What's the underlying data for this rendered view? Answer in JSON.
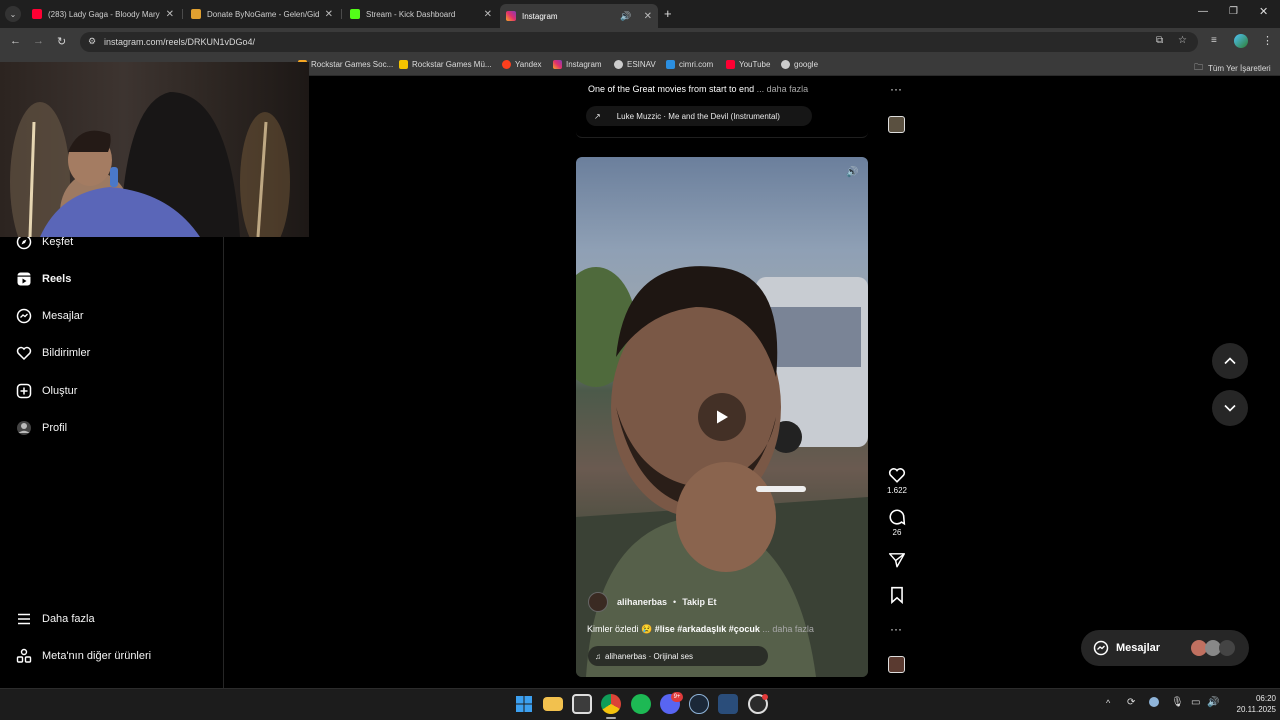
{
  "browser": {
    "tabs": [
      {
        "label": "(283) Lady Gaga - Bloody Mary",
        "favicon": "youtube-icon",
        "color": "#ff0033"
      },
      {
        "label": "Donate ByNoGame - Gelen/Giden",
        "favicon": "bynogame-icon",
        "color": "#e0a030"
      },
      {
        "label": "Stream - Kick Dashboard",
        "favicon": "kick-icon",
        "color": "#53fc18"
      },
      {
        "label": "Instagram",
        "favicon": "instagram-icon",
        "color": "#e1306c"
      }
    ],
    "url": "instagram.com/reels/DRKUN1vDGo4/",
    "bookmarks": [
      {
        "label": "Rockstar Games Soc...",
        "icon": "rockstar-icon",
        "color": "#f5a623"
      },
      {
        "label": "Rockstar Games Mü...",
        "icon": "rockstar-icon",
        "color": "#f5c400"
      },
      {
        "label": "Yandex",
        "icon": "yandex-icon",
        "color": "#fc3f1d"
      },
      {
        "label": "Instagram",
        "icon": "instagram-icon",
        "color": "#e1306c"
      },
      {
        "label": "ESINAV",
        "icon": "globe-icon",
        "color": "#cccccc"
      },
      {
        "label": "cimri.com",
        "icon": "cimri-icon",
        "color": "#2b8fe0"
      },
      {
        "label": "YouTube",
        "icon": "youtube-icon",
        "color": "#ff0033"
      },
      {
        "label": "google",
        "icon": "globe-icon",
        "color": "#cccccc"
      }
    ],
    "all_bookmarks": "Tüm Yer İşaretleri"
  },
  "sidebar": {
    "items": [
      {
        "label": "Keşfet",
        "icon": "compass-icon"
      },
      {
        "label": "Reels",
        "icon": "reels-icon"
      },
      {
        "label": "Mesajlar",
        "icon": "messenger-icon"
      },
      {
        "label": "Bildirimler",
        "icon": "heart-icon"
      },
      {
        "label": "Oluştur",
        "icon": "plus-square-icon"
      },
      {
        "label": "Profil",
        "icon": "avatar-icon"
      }
    ],
    "more": "Daha fazla",
    "meta": "Meta'nın diğer ürünleri"
  },
  "previous_reel": {
    "caption": "One of the Great movies from start to end",
    "more": "... daha fazla",
    "music": "Luke Muzzic · Me and the Devil (Instrumental)"
  },
  "reel": {
    "username": "alihanerbas",
    "follow": "Takip Et",
    "caption_text": "Kimler özledi 😢",
    "hashtags": "#lise #arkadaşlık #çocuk",
    "more": "... daha fazla",
    "audio": "alihanerbas · Orijinal ses",
    "likes": "1.622",
    "comments": "26"
  },
  "messages_pill": "Mesajlar",
  "taskbar": {
    "time": "06:20",
    "date": "20.11.2025",
    "discord_badge": "9+"
  },
  "colors": {
    "accent": "#e1306c",
    "bg": "#000000",
    "chrome": "#3a3a3a"
  }
}
